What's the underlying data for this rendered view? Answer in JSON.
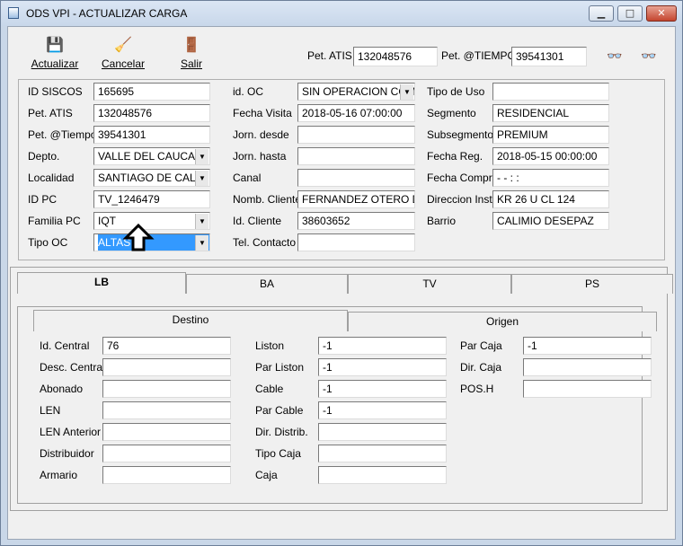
{
  "window": {
    "title": "ODS VPI - ACTUALIZAR CARGA",
    "min_glyph": "▁",
    "max_glyph": "□",
    "close_glyph": "✕"
  },
  "toolbar": {
    "actualizar_icon": "💾",
    "actualizar": "Actualizar",
    "cancelar_icon": "🧹",
    "cancelar": "Cancelar",
    "salir_icon": "🚪",
    "salir": "Salir",
    "pet_atis_label": "Pet. ATIS",
    "pet_atis_value": "132048576",
    "pet_tiempo_label": "Pet. @TIEMPO",
    "pet_tiempo_value": "39541301",
    "binoculars_glyph": "👓"
  },
  "form": {
    "col1": [
      {
        "label": "ID SISCOS",
        "value": "165695",
        "combo": false
      },
      {
        "label": "Pet. ATIS",
        "value": "132048576",
        "combo": false
      },
      {
        "label": "Pet. @Tiempo",
        "value": "39541301",
        "combo": false
      },
      {
        "label": "Depto.",
        "value": "VALLE DEL CAUCA",
        "combo": true
      },
      {
        "label": "Localidad",
        "value": "SANTIAGO DE CALI",
        "combo": true
      },
      {
        "label": "ID PC",
        "value": "TV_1246479",
        "combo": false
      },
      {
        "label": "Familia PC",
        "value": "IQT",
        "combo": true
      },
      {
        "label": "Tipo OC",
        "value": "ALTAS",
        "combo": true,
        "selected": true
      }
    ],
    "col2": [
      {
        "label": "id. OC",
        "value": "SIN OPERACION COM",
        "combo": true
      },
      {
        "label": "Fecha Visita",
        "value": "2018-05-16 07:00:00",
        "combo": false
      },
      {
        "label": "Jorn. desde",
        "value": "",
        "combo": false
      },
      {
        "label": "Jorn. hasta",
        "value": "",
        "combo": false
      },
      {
        "label": "Canal",
        "value": "",
        "combo": false
      },
      {
        "label": "Nomb. Cliente",
        "value": "FERNANDEZ OTERO DIA",
        "combo": false
      },
      {
        "label": "Id. Cliente",
        "value": "38603652",
        "combo": false
      },
      {
        "label": "Tel. Contacto",
        "value": "",
        "combo": false
      }
    ],
    "col3": [
      {
        "label": "Tipo de Uso",
        "value": ""
      },
      {
        "label": "Segmento",
        "value": "RESIDENCIAL"
      },
      {
        "label": "Subsegmento",
        "value": "PREMIUM"
      },
      {
        "label": "Fecha Reg.",
        "value": "2018-05-15 00:00:00"
      },
      {
        "label": "Fecha Compr.",
        "value": "  -  -     :  :"
      },
      {
        "label": "Direccion Inst.",
        "value": "KR  26  U      CL   124"
      },
      {
        "label": "Barrio",
        "value": "CALIMIO DESEPAZ"
      }
    ],
    "arrow_glyph": "⇧"
  },
  "tabs": [
    "LB",
    "BA",
    "TV",
    "PS"
  ],
  "subtabs": [
    "Destino",
    "Origen"
  ],
  "lb": {
    "col1": [
      {
        "label": "Id. Central",
        "value": "76"
      },
      {
        "label": "Desc. Central",
        "value": ""
      },
      {
        "label": "Abonado",
        "value": ""
      },
      {
        "label": "LEN",
        "value": ""
      },
      {
        "label": "LEN Anterior",
        "value": ""
      },
      {
        "label": "Distribuidor",
        "value": ""
      },
      {
        "label": "Armario",
        "value": ""
      }
    ],
    "col2": [
      {
        "label": "Liston",
        "value": "-1"
      },
      {
        "label": "Par Liston",
        "value": "-1"
      },
      {
        "label": "Cable",
        "value": "-1"
      },
      {
        "label": "Par Cable",
        "value": "-1"
      },
      {
        "label": "Dir. Distrib.",
        "value": ""
      },
      {
        "label": "Tipo Caja",
        "value": ""
      },
      {
        "label": "Caja",
        "value": ""
      }
    ],
    "col3": [
      {
        "label": "Par Caja",
        "value": "-1"
      },
      {
        "label": "Dir. Caja",
        "value": ""
      },
      {
        "label": "POS.H",
        "value": ""
      }
    ]
  }
}
